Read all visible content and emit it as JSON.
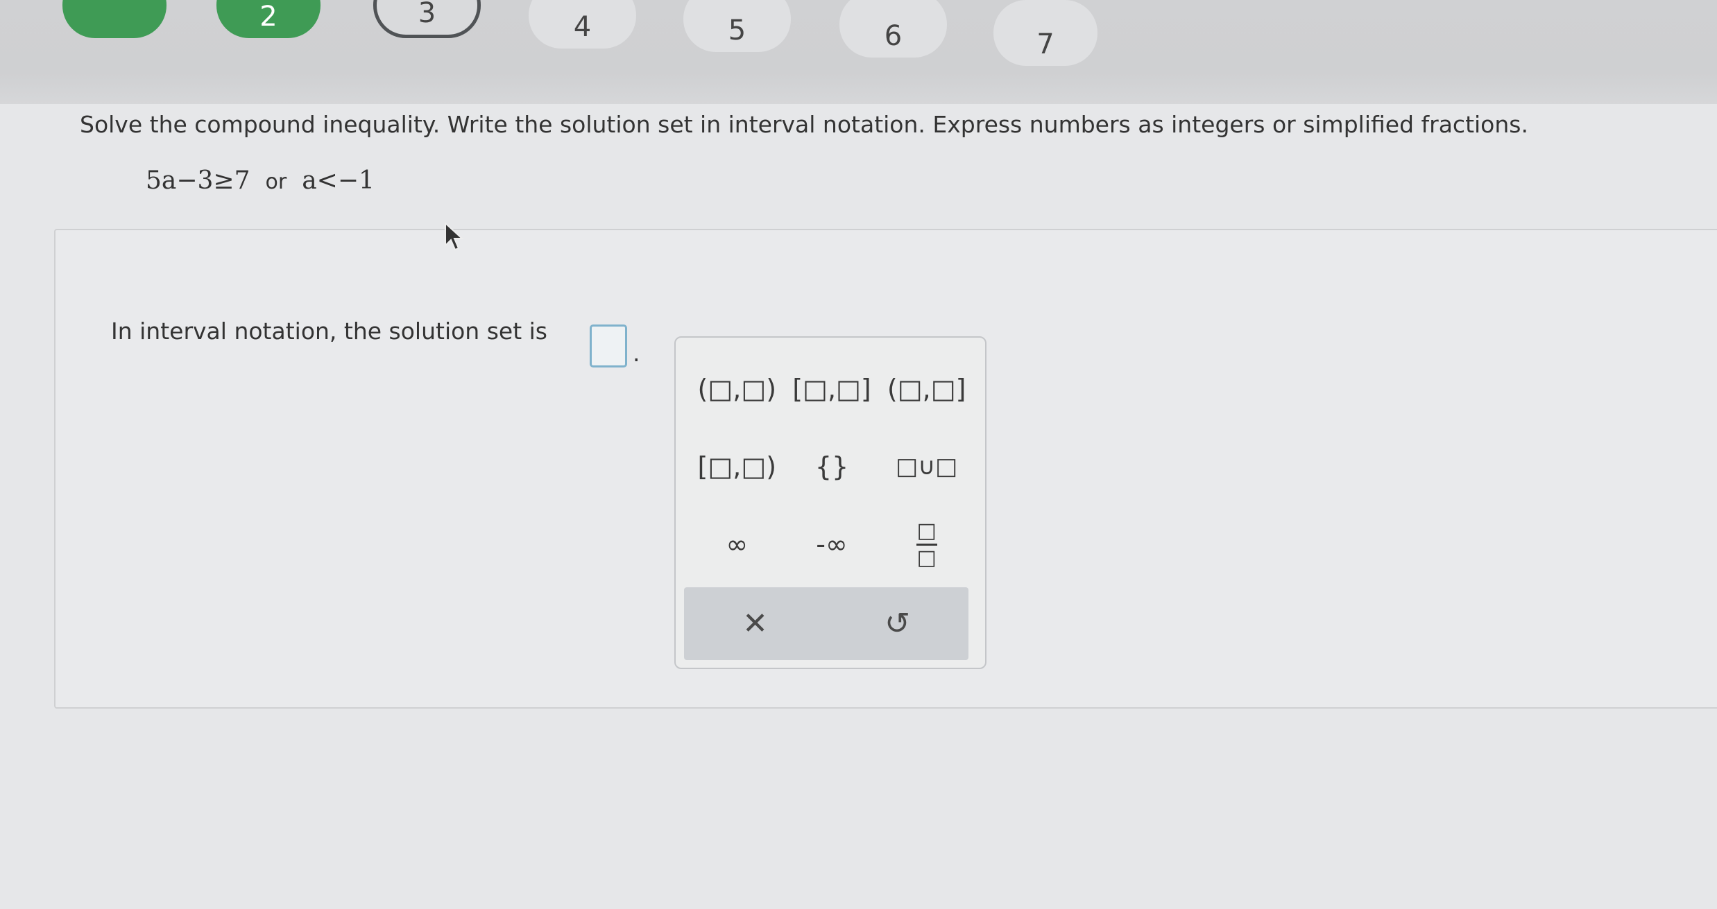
{
  "nav": {
    "steps": [
      {
        "label": "",
        "state": "done"
      },
      {
        "label": "2",
        "state": "done"
      },
      {
        "label": "3",
        "state": "current"
      },
      {
        "label": "4",
        "state": "pending"
      },
      {
        "label": "5",
        "state": "pending"
      },
      {
        "label": "6",
        "state": "pending"
      },
      {
        "label": "7",
        "state": "pending"
      }
    ]
  },
  "question": {
    "instruction": "Solve the compound inequality. Write the solution set in interval notation. Express numbers as integers or simplified fractions.",
    "inequality_left": "5a−3≥7",
    "connector": "or",
    "inequality_right": "a<−1"
  },
  "answer": {
    "prompt": "In interval notation, the solution set is",
    "value": "",
    "period": "."
  },
  "palette": {
    "buttons": [
      {
        "label": "(□,□)"
      },
      {
        "label": "[□,□]"
      },
      {
        "label": "(□,□]"
      },
      {
        "label": "[□,□)"
      },
      {
        "label": "{}"
      },
      {
        "label": "□∪□"
      },
      {
        "label": "∞"
      },
      {
        "label": "-∞"
      }
    ],
    "fraction": {
      "numerator": "□",
      "denominator": "□"
    },
    "clear_icon": "✕",
    "undo_icon": "↺"
  },
  "colors": {
    "done": "#3f9b55",
    "answer_box_border": "#7fb2cc"
  }
}
